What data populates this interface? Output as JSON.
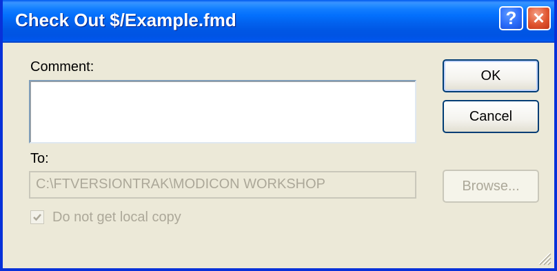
{
  "window": {
    "title": "Check Out $/Example.fmd",
    "help_glyph": "?",
    "close_glyph": "✕"
  },
  "comment": {
    "label": "Comment:",
    "value": ""
  },
  "to": {
    "label": "To:",
    "value": "C:\\FTVERSIONTRAK\\MODICON WORKSHOP"
  },
  "options": {
    "no_local_copy_label": "Do not get local copy",
    "no_local_copy_checked": true,
    "no_local_copy_enabled": false
  },
  "buttons": {
    "ok": "OK",
    "cancel": "Cancel",
    "browse": "Browse..."
  },
  "colors": {
    "titlebar": "#0054e3",
    "dialog_bg": "#ece9d8",
    "disabled_text": "#aca899"
  },
  "icons": {
    "help": "help-icon",
    "close": "close-icon",
    "check": "checkmark-icon",
    "grip": "resize-grip-icon"
  }
}
